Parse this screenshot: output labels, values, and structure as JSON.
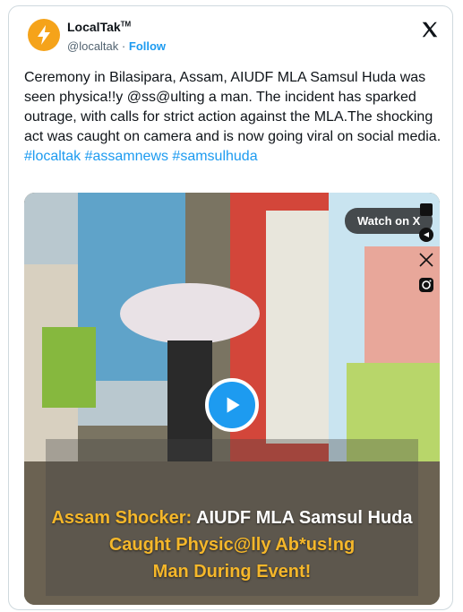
{
  "author": {
    "name": "LocalTak",
    "trademark": "TM",
    "handle": "@localtak",
    "separator": "·",
    "follow_label": "Follow"
  },
  "tweet": {
    "text": "Ceremony in Bilasipara, Assam, AIUDF MLA Samsul Huda was seen physica!!y @ss@ulting a man. The incident has sparked outrage, with calls for strict action against the MLA.The shocking act was caught on camera and is now going viral on social media.",
    "hashtags": "#localtak #assamnews #samsulhuda"
  },
  "media": {
    "watch_label": "Watch on X",
    "caption_line1_a": "Assam Shocker: ",
    "caption_line1_b": "AIUDF MLA Samsul Huda",
    "caption_line2": "Caught Physic@lly Ab*us!ng",
    "caption_line3": "Man During Event!"
  },
  "icons": [
    "localtak-logo-icon",
    "x-logo-icon",
    "video-menu-icon",
    "video-share-icon",
    "video-x-icon",
    "instagram-icon",
    "play-icon"
  ],
  "colors": {
    "accent": "#1d9bf0",
    "caption_yellow": "#f5b72a",
    "avatar_orange": "#f5a31a"
  }
}
